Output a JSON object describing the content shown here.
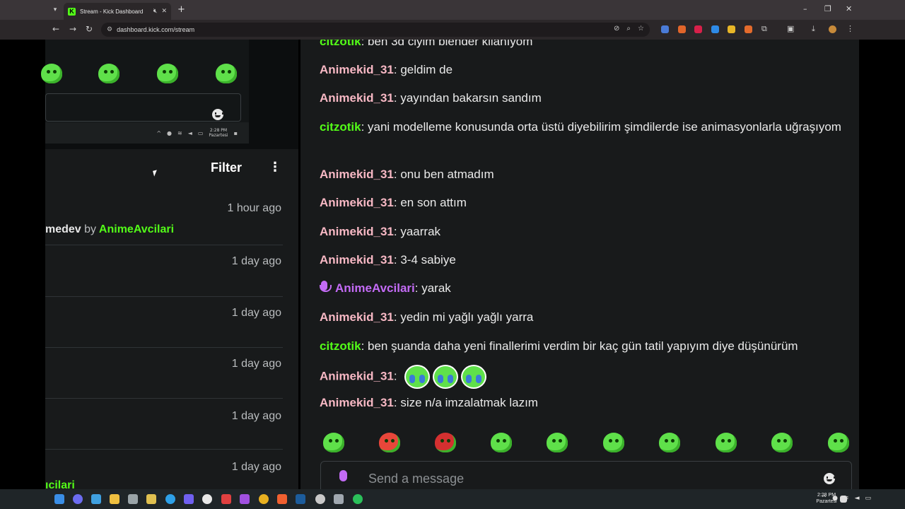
{
  "browser": {
    "tab_title": "Stream - Kick Dashboard",
    "url": "dashboard.kick.com/stream"
  },
  "preview": {
    "clock_time": "2:28 PM",
    "clock_day": "Pazartesi"
  },
  "activity": {
    "filter_label": "Filter",
    "items": [
      {
        "time": "1 hour ago",
        "text": "medev",
        "by": "by",
        "user": "AnimeAvcilari"
      },
      {
        "time": "1 day ago"
      },
      {
        "time": "1 day ago"
      },
      {
        "time": "1 day ago"
      },
      {
        "time": "1 day ago"
      },
      {
        "time": "1 day ago",
        "user_partial": "ıcilari"
      }
    ]
  },
  "chat": {
    "messages": [
      {
        "user": "citzotik",
        "text": "ben 3d ciyim blender kllanıyom",
        "color": "green"
      },
      {
        "user": "Animekid_31",
        "text": "geldim de",
        "color": "pink"
      },
      {
        "user": "Animekid_31",
        "text": "yayından bakarsın sandım",
        "color": "pink"
      },
      {
        "user": "citzotik",
        "text": "yani modelleme konusunda orta üstü diyebilirim şimdilerde ise animasyonlarla uğraşıyom",
        "color": "green"
      },
      {
        "user": "Animekid_31",
        "text": "onu ben atmadım",
        "color": "pink"
      },
      {
        "user": "Animekid_31",
        "text": "en son attım",
        "color": "pink"
      },
      {
        "user": "Animekid_31",
        "text": "yaarrak",
        "color": "pink"
      },
      {
        "user": "Animekid_31",
        "text": "3-4 sabiye",
        "color": "pink"
      },
      {
        "user": "AnimeAvcilari",
        "text": "yarak",
        "color": "purple"
      },
      {
        "user": "Animekid_31",
        "text": "yedin mi yağlı yağlı yarra",
        "color": "pink"
      },
      {
        "user": "citzotik",
        "text": "ben şuanda daha yeni finallerimi verdim bir kaç gün tatil yapıyım diye düşünürüm",
        "color": "green"
      },
      {
        "user": "Animekid_31",
        "text": "",
        "color": "pink"
      },
      {
        "user": "Animekid_31",
        "text": "size n/a imzalatmak lazım",
        "color": "pink"
      }
    ],
    "input_placeholder": "Send a message"
  },
  "taskbar": {
    "time": "2:28 PM",
    "day": "Pazartesi"
  },
  "colors": {
    "kick_green": "#53fc18",
    "username_pink": "#f7b8c4",
    "mod_purple": "#c36bf5"
  }
}
